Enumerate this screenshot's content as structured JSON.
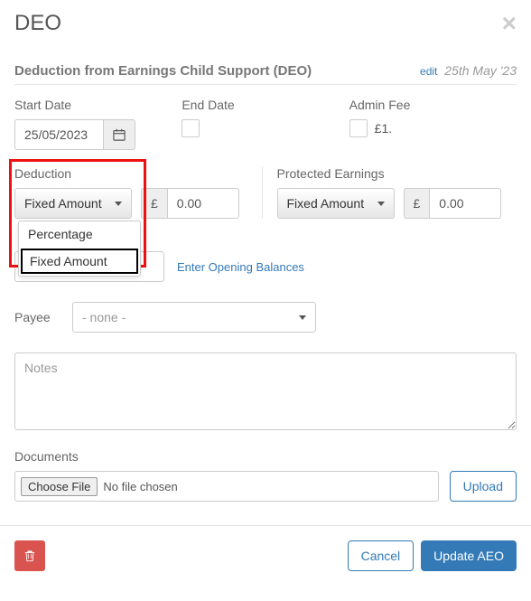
{
  "modal": {
    "title": "DEO",
    "section_title": "Deduction from Earnings Child Support (DEO)",
    "edit_label": "edit",
    "edit_date": "25th May '23"
  },
  "dates": {
    "start_label": "Start Date",
    "start_value": "25/05/2023",
    "end_label": "End Date"
  },
  "admin_fee": {
    "label": "Admin Fee",
    "value_text": "£1."
  },
  "deduction": {
    "label": "Deduction",
    "selected": "Fixed Amount",
    "currency": "£",
    "amount": "0.00",
    "options": [
      "Percentage",
      "Fixed Amount"
    ],
    "active_option": "Fixed Amount"
  },
  "protected_earnings": {
    "label": "Protected Earnings",
    "selected": "Fixed Amount",
    "currency": "£",
    "amount": "0.00"
  },
  "priority": {
    "value": "",
    "balances_link": "Enter Opening Balances"
  },
  "payee": {
    "label": "Payee",
    "selected": "- none -"
  },
  "notes": {
    "placeholder": "Notes"
  },
  "documents": {
    "label": "Documents",
    "choose_label": "Choose File",
    "status": "No file chosen",
    "upload_label": "Upload"
  },
  "footer": {
    "cancel": "Cancel",
    "submit": "Update AEO"
  }
}
